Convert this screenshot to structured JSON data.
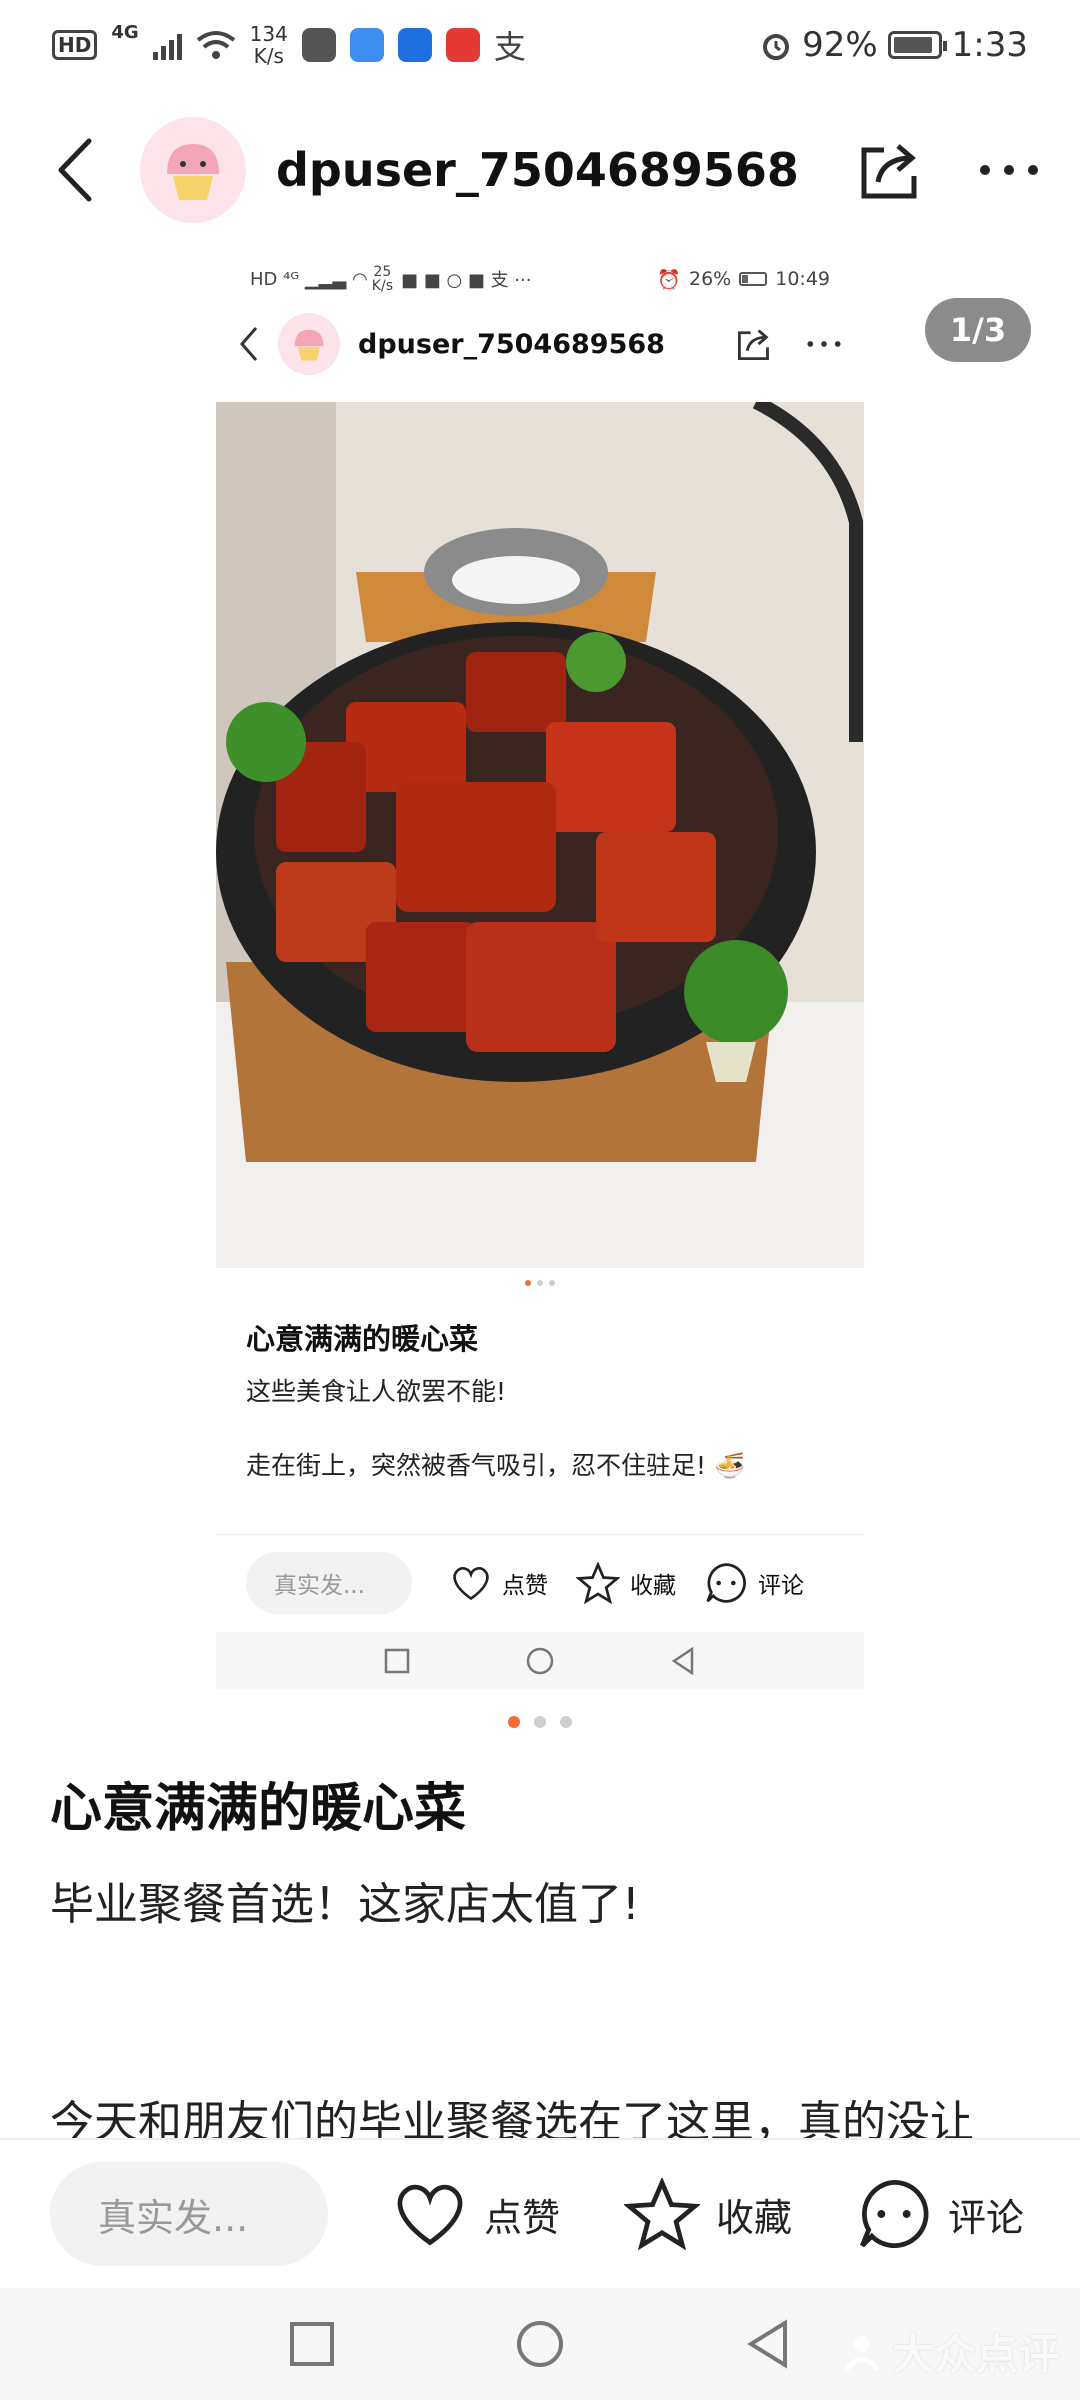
{
  "status_bar": {
    "hd": "HD",
    "network": "4G",
    "speed": "134",
    "speed_unit": "K/s",
    "battery": "92%",
    "battery_level": 0.92,
    "time": "1:33"
  },
  "header": {
    "username": "dpuser_7504689568"
  },
  "page_counter": "1/3",
  "embedded": {
    "status": {
      "speed": "25",
      "speed_unit": "K/s",
      "battery": "26%",
      "battery_level": 0.26,
      "time": "10:49"
    },
    "username": "dpuser_7504689568",
    "title": "心意满满的暖心菜",
    "line1": "这些美食让人欲罢不能!",
    "line2": "走在街上，突然被香气吸引，忍不住驻足!",
    "input_placeholder": "真实发...",
    "like": "点赞",
    "collect": "收藏",
    "comment": "评论"
  },
  "note": {
    "title": "心意满满的暖心菜",
    "subtitle": "毕业聚餐首选！这家店太值了!",
    "body_start": "今天和朋友们的毕业聚餐选在了这里，真的没让"
  },
  "action_bar": {
    "input_placeholder": "真实发...",
    "like": "点赞",
    "collect": "收藏",
    "comment": "评论"
  },
  "watermark": "大众点评",
  "colors": {
    "accent": "#f06a3c",
    "counter_bg": "#8b8b8b"
  }
}
